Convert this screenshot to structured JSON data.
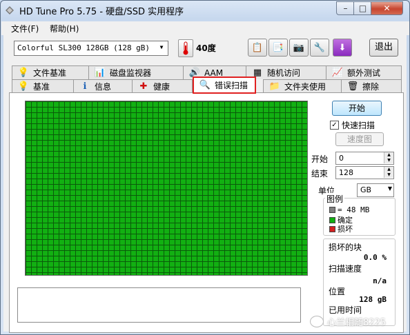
{
  "window": {
    "title": "HD Tune Pro 5.75 - 硬盘/SSD 实用程序",
    "controls": {
      "minimize": "–",
      "maximize": "□",
      "close": "✕"
    }
  },
  "menu": [
    {
      "label": "文件(F)"
    },
    {
      "label": "帮助(H)"
    }
  ],
  "toolbar": {
    "drive": "Colorful SL300 128GB (128 gB)",
    "temperature": "40度",
    "exit_label": "退出",
    "icons": [
      "copy-text-icon",
      "copy-screen-icon",
      "camera-icon",
      "options-icon",
      "save-icon"
    ]
  },
  "tabs_row1": [
    {
      "label": "文件基准",
      "icon": "file-benchmark-icon",
      "glyph": "💡"
    },
    {
      "label": "磁盘监视器",
      "icon": "disk-monitor-icon",
      "glyph": "📊"
    },
    {
      "label": "AAM",
      "icon": "speaker-icon",
      "glyph": "🔊"
    },
    {
      "label": "随机访问",
      "icon": "random-access-icon",
      "glyph": "▦"
    },
    {
      "label": "额外测试",
      "icon": "extra-tests-icon",
      "glyph": "📈"
    }
  ],
  "tabs_row2": [
    {
      "label": "基准",
      "icon": "benchmark-icon",
      "glyph": "💡"
    },
    {
      "label": "信息",
      "icon": "info-icon",
      "glyph": "ℹ"
    },
    {
      "label": "健康",
      "icon": "health-icon",
      "glyph": "✚"
    },
    {
      "label": "错误扫描",
      "icon": "magnifier-icon",
      "glyph": "🔍"
    },
    {
      "label": "文件夹使用",
      "icon": "folder-icon",
      "glyph": "📁"
    },
    {
      "label": "擦除",
      "icon": "trash-icon",
      "glyph": "🗑"
    }
  ],
  "active_tab": "错误扫描",
  "scan": {
    "start_button": "开始",
    "quick_scan_label": "快速扫描",
    "quick_scan_checked": true,
    "speed_map_button": "速度图",
    "start_label": "开始",
    "start_value": "0",
    "end_label": "结束",
    "end_value": "128",
    "unit_label": "单位",
    "unit_value": "GB",
    "legend": {
      "title": "图例",
      "block_size": "= 48 MB",
      "ok_label": "确定",
      "damaged_label": "损坏"
    },
    "stats": {
      "damaged_blocks_label": "损坏的块",
      "damaged_blocks_value": "0.0 %",
      "scan_speed_label": "扫描速度",
      "scan_speed_value": "n/a",
      "position_label": "位置",
      "position_value": "128 gB",
      "elapsed_label": "已用时间"
    },
    "block_colors": {
      "ok": "#12b012",
      "damaged": "#d42020",
      "unknown": "#808080"
    }
  },
  "watermark": "心兰相随8225"
}
